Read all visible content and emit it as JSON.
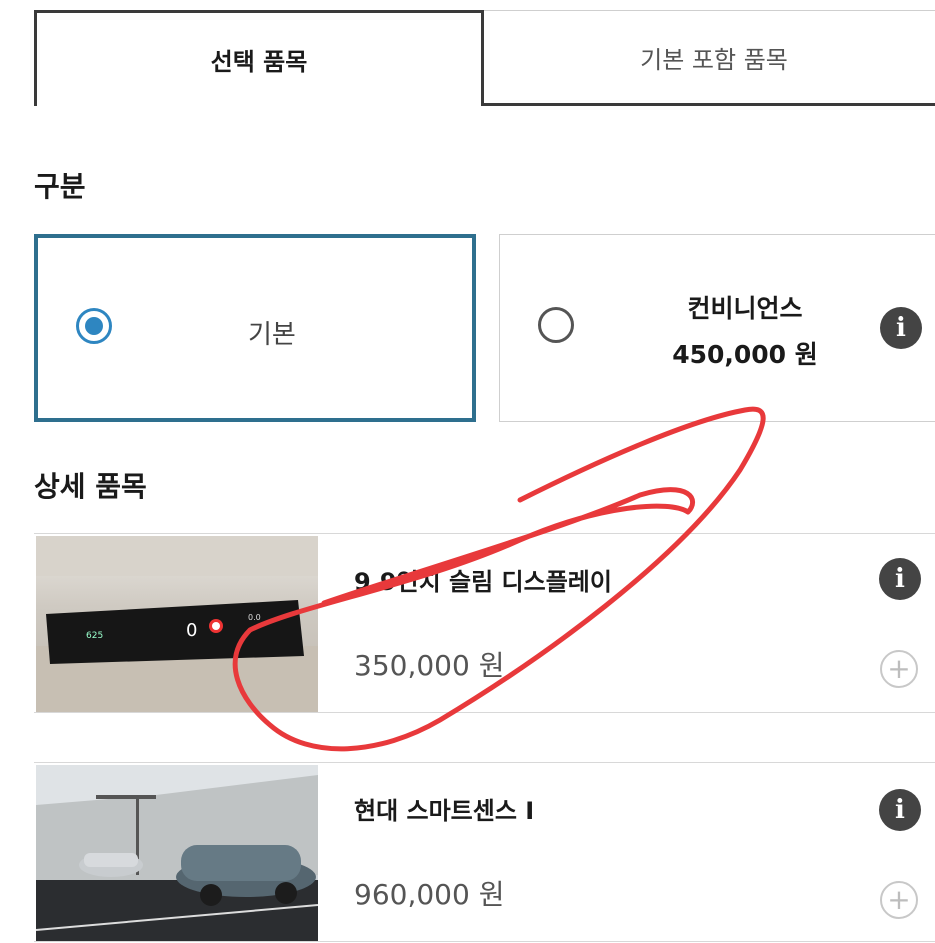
{
  "tabs": [
    {
      "label": "선택 품목",
      "active": true
    },
    {
      "label": "기본 포함 품목",
      "active": false
    }
  ],
  "category": {
    "title": "구분",
    "options": [
      {
        "label": "기본",
        "selected": true
      },
      {
        "label": "컨비니언스",
        "price": "450,000 원",
        "selected": false
      }
    ]
  },
  "details": {
    "title": "상세 품목",
    "items": [
      {
        "name": "9.9인치 슬림 디스플레이",
        "price": "350,000 원",
        "image": "dashboard-display-photo"
      },
      {
        "name": "현대 스마트센스 I",
        "price": "960,000 원",
        "image": "cars-on-road-photo"
      }
    ]
  },
  "colors": {
    "accent": "#2e86c1",
    "selected_border": "#2e6f8e",
    "annotation_red": "#e8393b"
  }
}
